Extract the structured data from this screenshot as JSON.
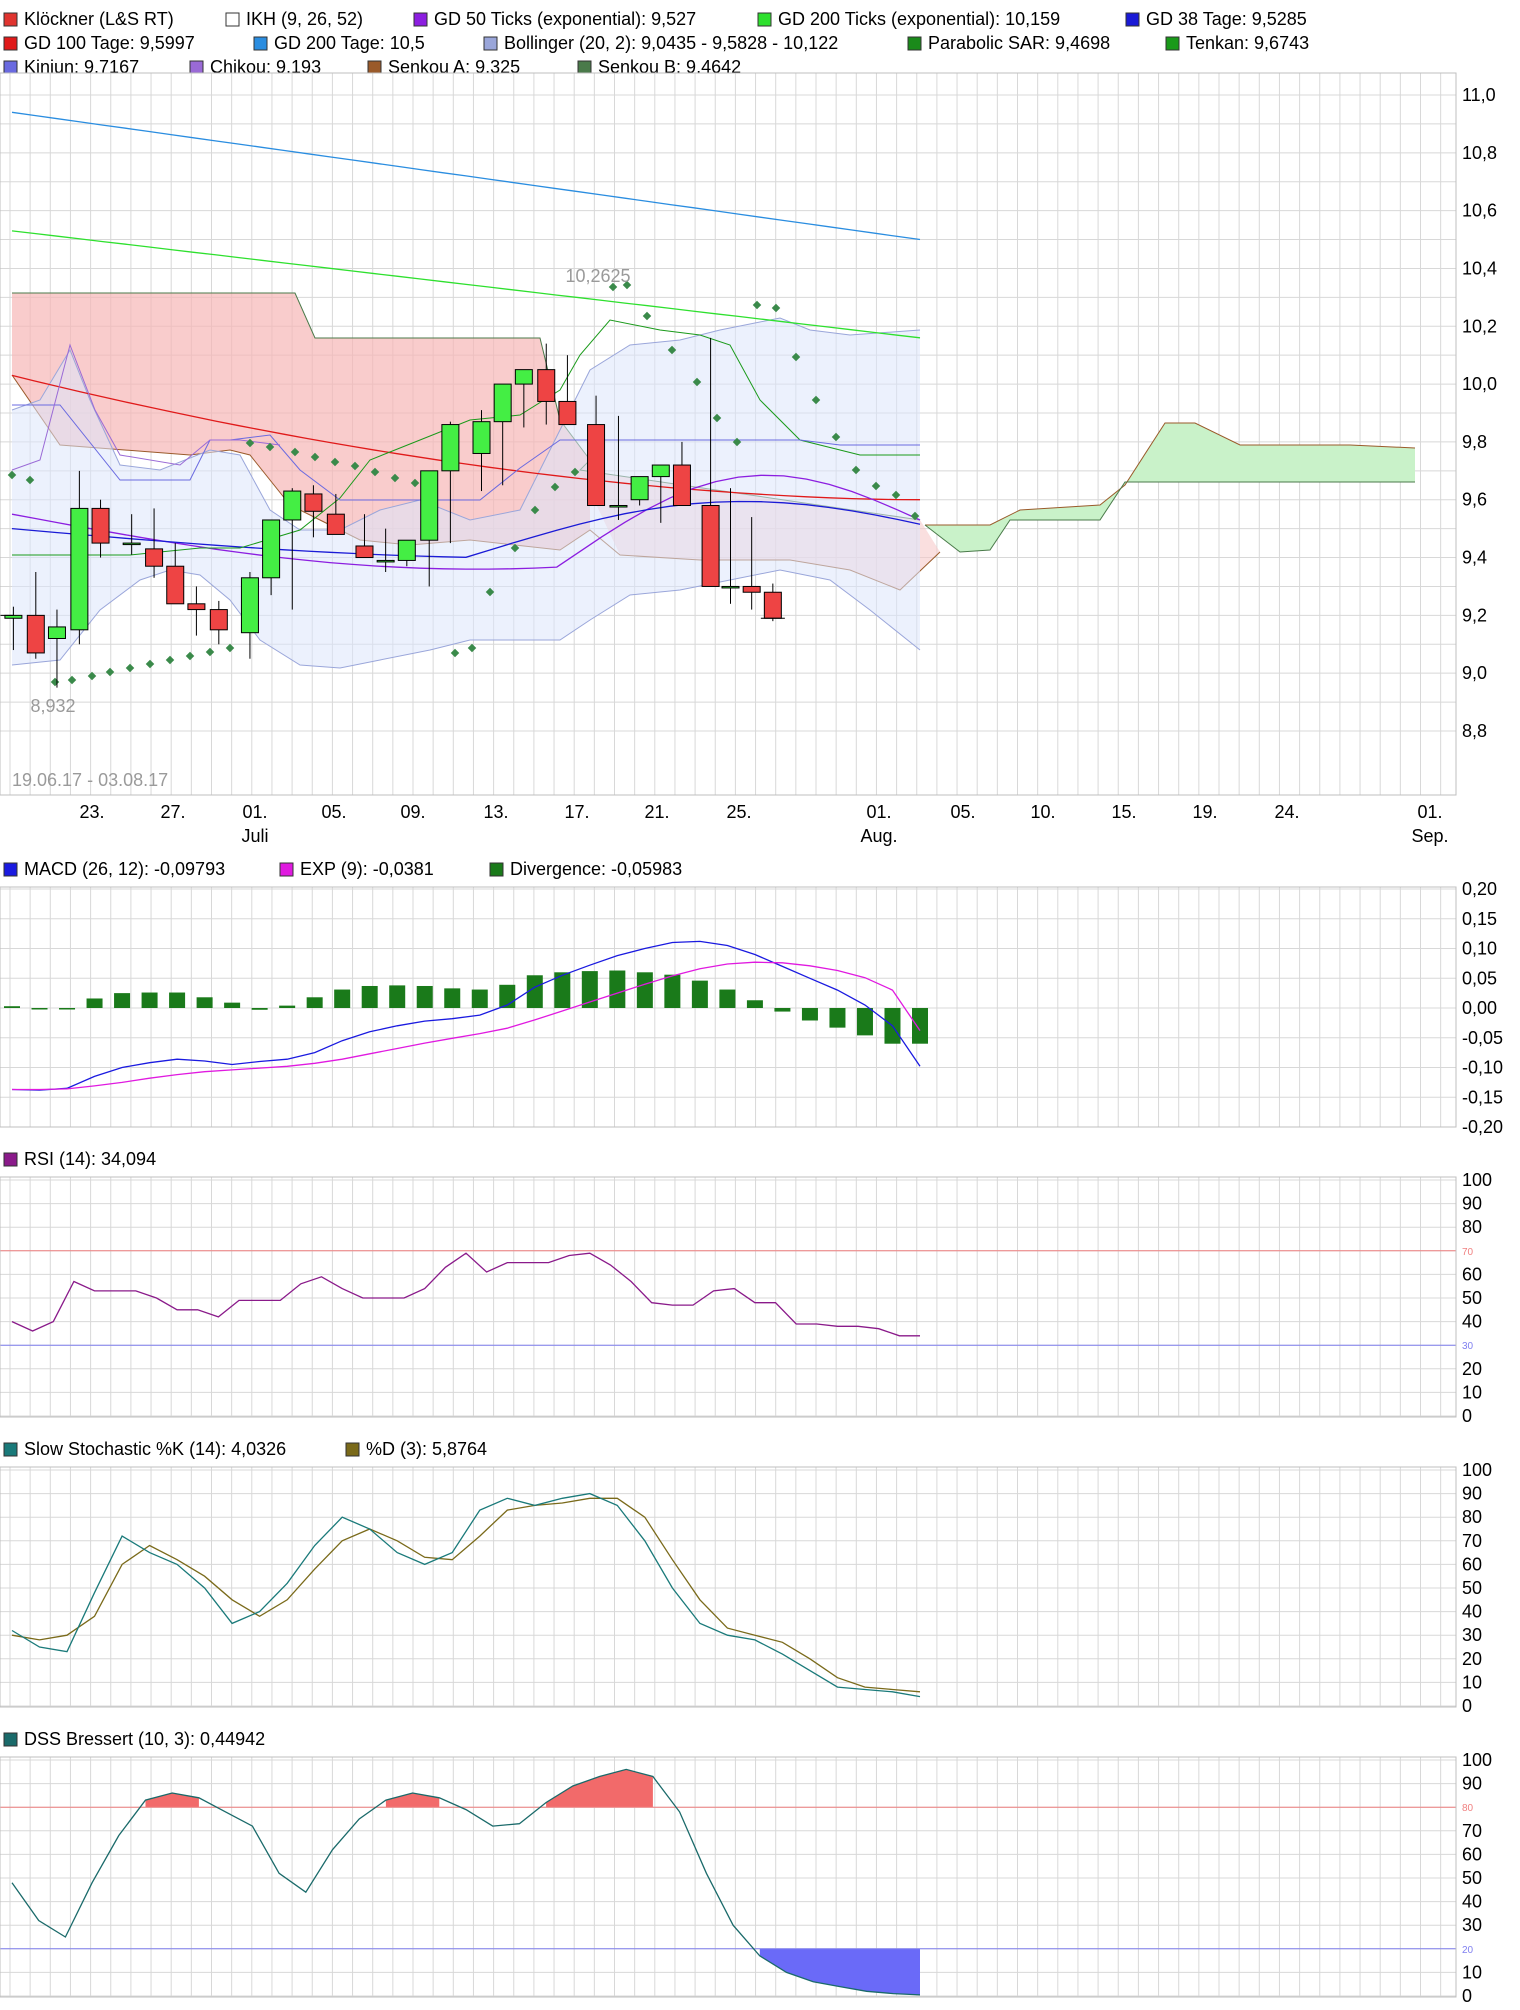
{
  "legend_top": [
    {
      "label": "Klöckner (L&S RT)",
      "color": "#e0342f"
    },
    {
      "label": "IKH (9, 26, 52)",
      "color": "#ffffff"
    },
    {
      "label": "GD 50 Ticks (exponential): 9,527",
      "color": "#8c1ee0"
    },
    {
      "label": "GD 200 Ticks (exponential): 10,159",
      "color": "#2ee02e"
    },
    {
      "label": "GD 38 Tage: 9,5285",
      "color": "#1a1ad6"
    },
    {
      "label": "GD 100 Tage: 9,5997",
      "color": "#e01a1a"
    },
    {
      "label": "GD 200 Tage: 10,5",
      "color": "#2a8de0"
    },
    {
      "label": "Bollinger (20, 2): 9,0435 - 9,5828 - 10,122",
      "color": "#9aa6da"
    },
    {
      "label": "Parabolic SAR: 9,4698",
      "color": "#1a8a1a"
    },
    {
      "label": "Tenkan: 9,6743",
      "color": "#1a9a1a"
    },
    {
      "label": "Kinjun: 9,7167",
      "color": "#6a6ae0"
    },
    {
      "label": "Chikou: 9,193",
      "color": "#9a6ad6"
    },
    {
      "label": "Senkou A: 9,325",
      "color": "#9a5a2a"
    },
    {
      "label": "Senkou B: 9,4642",
      "color": "#4a7a4a"
    }
  ],
  "main_chart": {
    "date_range": "19.06.17 - 03.08.17",
    "high_label": "10,2625",
    "low_label": "8,932",
    "y_ticks": [
      "11,0",
      "10,8",
      "10,6",
      "10,4",
      "10,2",
      "10,0",
      "9,8",
      "9,6",
      "9,4",
      "9,2",
      "9,0",
      "8,8"
    ],
    "x_ticks": [
      {
        "label": "23.",
        "sub": ""
      },
      {
        "label": "27.",
        "sub": ""
      },
      {
        "label": "01.",
        "sub": "Juli"
      },
      {
        "label": "05.",
        "sub": ""
      },
      {
        "label": "09.",
        "sub": ""
      },
      {
        "label": "13.",
        "sub": ""
      },
      {
        "label": "17.",
        "sub": ""
      },
      {
        "label": "21.",
        "sub": ""
      },
      {
        "label": "25.",
        "sub": ""
      },
      {
        "label": "01.",
        "sub": "Aug."
      },
      {
        "label": "05.",
        "sub": ""
      },
      {
        "label": "10.",
        "sub": ""
      },
      {
        "label": "15.",
        "sub": ""
      },
      {
        "label": "19.",
        "sub": ""
      },
      {
        "label": "24.",
        "sub": ""
      },
      {
        "label": "01.",
        "sub": "Sep."
      }
    ],
    "colors": {
      "up": "#44ee44",
      "down": "#ee4444",
      "outline": "#000000"
    }
  },
  "macd_panel": {
    "legend": [
      {
        "label": "MACD (26, 12): -0,09793",
        "color": "#1a1ae0"
      },
      {
        "label": "EXP (9): -0,0381",
        "color": "#e01ae0"
      },
      {
        "label": "Divergence: -0,05983",
        "color": "#1a7a1a"
      }
    ],
    "y_ticks": [
      "0,20",
      "0,15",
      "0,10",
      "0,05",
      "0,00",
      "-0,05",
      "-0,10",
      "-0,15",
      "-0,20"
    ]
  },
  "rsi_panel": {
    "legend": [
      {
        "label": "RSI (14): 34,094",
        "color": "#8a1a8a"
      }
    ],
    "y_ticks": [
      "100",
      "90",
      "80",
      "60",
      "50",
      "40",
      "20",
      "10",
      "0"
    ],
    "line_70": "70",
    "line_30": "30"
  },
  "stoch_panel": {
    "legend": [
      {
        "label": "Slow Stochastic %K (14): 4,0326",
        "color": "#1a7a7a"
      },
      {
        "label": "%D (3): 5,8764",
        "color": "#7a6a1a"
      }
    ],
    "y_ticks": [
      "100",
      "90",
      "80",
      "70",
      "60",
      "50",
      "40",
      "30",
      "20",
      "10",
      "0"
    ]
  },
  "dss_panel": {
    "legend": [
      {
        "label": "DSS Bressert (10, 3): 0,44942",
        "color": "#1a6a6a"
      }
    ],
    "y_ticks": [
      "100",
      "90",
      "70",
      "60",
      "50",
      "40",
      "30",
      "10",
      "0"
    ],
    "line_80": "80",
    "line_20": "20"
  },
  "chart_data": [
    {
      "type": "candlestick",
      "title": "Klöckner (L&S RT)",
      "dates": [
        "19.06",
        "20.06",
        "21.06",
        "22.06",
        "23.06",
        "26.06",
        "27.06",
        "28.06",
        "29.06",
        "30.06",
        "03.07",
        "04.07",
        "05.07",
        "06.07",
        "07.07",
        "10.07",
        "11.07",
        "12.07",
        "13.07",
        "14.07",
        "17.07",
        "18.07",
        "19.07",
        "20.07",
        "21.07",
        "24.07",
        "25.07",
        "26.07",
        "27.07",
        "28.07",
        "31.07",
        "01.08",
        "02.08",
        "03.08"
      ],
      "open": [
        9.19,
        9.2,
        9.12,
        9.15,
        9.57,
        9.45,
        9.43,
        9.37,
        9.24,
        9.22,
        9.14,
        9.33,
        9.53,
        9.62,
        9.55,
        9.44,
        9.39,
        9.39,
        9.46,
        9.7,
        9.76,
        9.87,
        10.0,
        10.05,
        9.94,
        9.86,
        9.58,
        9.6,
        9.68,
        9.72,
        9.58,
        9.3,
        9.3,
        9.28
      ],
      "high": [
        9.23,
        9.35,
        9.22,
        9.7,
        9.6,
        9.55,
        9.57,
        9.45,
        9.3,
        9.25,
        9.35,
        9.53,
        9.64,
        9.65,
        9.62,
        9.55,
        9.5,
        9.43,
        9.58,
        9.87,
        9.91,
        9.91,
        10.01,
        10.14,
        10.1,
        9.96,
        9.89,
        9.6,
        9.7,
        9.8,
        10.16,
        9.64,
        9.54,
        9.31
      ],
      "low": [
        9.08,
        9.05,
        8.95,
        9.1,
        9.4,
        9.41,
        9.33,
        9.3,
        9.13,
        9.1,
        9.05,
        9.27,
        9.22,
        9.47,
        9.54,
        9.4,
        9.35,
        9.37,
        9.3,
        9.45,
        9.63,
        9.65,
        9.85,
        9.86,
        9.93,
        9.84,
        9.53,
        9.58,
        9.52,
        9.62,
        9.46,
        9.24,
        9.22,
        9.18
      ],
      "close": [
        9.2,
        9.07,
        9.16,
        9.57,
        9.45,
        9.45,
        9.37,
        9.24,
        9.22,
        9.15,
        9.33,
        9.53,
        9.63,
        9.56,
        9.48,
        9.4,
        9.39,
        9.46,
        9.7,
        9.86,
        9.87,
        10.0,
        10.05,
        9.94,
        9.86,
        9.58,
        9.58,
        9.68,
        9.72,
        9.58,
        9.3,
        9.3,
        9.28,
        9.19
      ],
      "moving_averages": {
        "GD 200 Tage": {
          "start": 10.94,
          "end": 10.5
        },
        "GD 200 Ticks (exponential)": {
          "start": 10.53,
          "end": 10.16
        },
        "GD 100 Tage": {
          "start": 10.03,
          "end": 9.6
        },
        "GD 50 Ticks (exponential)": {
          "start": 9.55,
          "end": 9.53
        },
        "GD 38 Tage": {
          "start": 9.5,
          "end": 9.53
        }
      },
      "ylim": [
        8.75,
        11.05
      ]
    },
    {
      "type": "line",
      "title": "MACD (26, 12)",
      "series": [
        {
          "name": "MACD (26, 12)",
          "values": [
            -0.137,
            -0.138,
            -0.135,
            -0.115,
            -0.1,
            -0.092,
            -0.086,
            -0.089,
            -0.095,
            -0.09,
            -0.086,
            -0.075,
            -0.055,
            -0.04,
            -0.03,
            -0.022,
            -0.018,
            -0.012,
            0.005,
            0.035,
            0.055,
            0.072,
            0.088,
            0.1,
            0.11,
            0.112,
            0.105,
            0.09,
            0.07,
            0.05,
            0.03,
            0.005,
            -0.03,
            -0.098
          ]
        },
        {
          "name": "EXP (9)",
          "values": [
            -0.137,
            -0.137,
            -0.136,
            -0.131,
            -0.125,
            -0.118,
            -0.112,
            -0.107,
            -0.104,
            -0.101,
            -0.098,
            -0.093,
            -0.086,
            -0.077,
            -0.068,
            -0.059,
            -0.051,
            -0.043,
            -0.034,
            -0.02,
            -0.005,
            0.01,
            0.025,
            0.04,
            0.054,
            0.066,
            0.074,
            0.077,
            0.076,
            0.071,
            0.063,
            0.051,
            0.03,
            -0.038
          ]
        },
        {
          "name": "Divergence",
          "values": [
            0.003,
            0.0,
            -0.001,
            0.016,
            0.025,
            0.026,
            0.026,
            0.018,
            0.009,
            -0.003,
            0.004,
            0.018,
            0.031,
            0.037,
            0.038,
            0.037,
            0.033,
            0.031,
            0.039,
            0.055,
            0.06,
            0.062,
            0.063,
            0.06,
            0.056,
            0.046,
            0.031,
            0.013,
            -0.006,
            -0.021,
            -0.033,
            -0.046,
            -0.06,
            -0.06
          ]
        }
      ],
      "ylim": [
        -0.2,
        0.2
      ]
    },
    {
      "type": "line",
      "title": "RSI (14)",
      "series": [
        {
          "name": "RSI (14)",
          "values": [
            40,
            36,
            40,
            57,
            53,
            53,
            53,
            50,
            45,
            45,
            42,
            49,
            49,
            49,
            56,
            59,
            54,
            50,
            50,
            50,
            54,
            63,
            69,
            61,
            65,
            65,
            65,
            68,
            69,
            64,
            57,
            48,
            47,
            47,
            53,
            54,
            48,
            48,
            39,
            39,
            38,
            38,
            37,
            34,
            34
          ]
        }
      ],
      "ylim": [
        0,
        100
      ]
    },
    {
      "type": "line",
      "title": "Slow Stochastic",
      "series": [
        {
          "name": "Slow Stochastic %K (14)",
          "values": [
            32,
            25,
            23,
            48,
            72,
            65,
            60,
            50,
            35,
            40,
            52,
            68,
            80,
            75,
            65,
            60,
            65,
            83,
            88,
            85,
            88,
            90,
            85,
            70,
            50,
            35,
            30,
            28,
            22,
            15,
            8,
            7,
            6,
            4
          ]
        },
        {
          "name": "%D (3)",
          "values": [
            30,
            28,
            30,
            38,
            60,
            68,
            62,
            55,
            45,
            38,
            45,
            58,
            70,
            75,
            70,
            63,
            62,
            72,
            83,
            85,
            86,
            88,
            88,
            80,
            62,
            45,
            33,
            30,
            27,
            20,
            12,
            8,
            7,
            6
          ]
        }
      ],
      "ylim": [
        0,
        100
      ]
    },
    {
      "type": "line",
      "title": "DSS Bressert (10, 3)",
      "series": [
        {
          "name": "DSS Bressert (10, 3)",
          "values": [
            48,
            32,
            25,
            48,
            68,
            83,
            86,
            84,
            78,
            72,
            52,
            44,
            62,
            75,
            83,
            86,
            84,
            79,
            72,
            73,
            82,
            89,
            93,
            96,
            93,
            78,
            52,
            30,
            17,
            10,
            6,
            4,
            2,
            1,
            0.45
          ]
        }
      ],
      "ylim": [
        0,
        100
      ]
    }
  ]
}
